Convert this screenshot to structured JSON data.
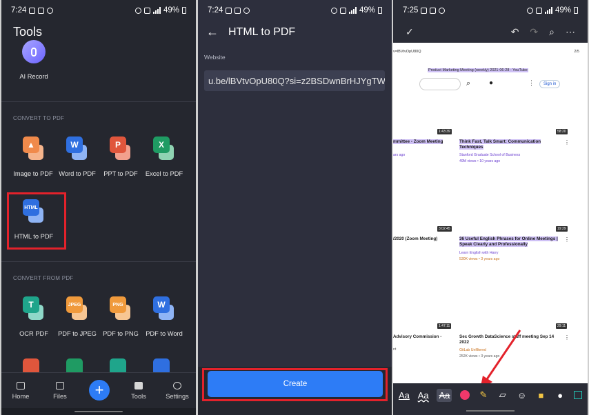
{
  "panel1": {
    "status": {
      "time": "7:24",
      "battery": "49%"
    },
    "title": "Tools",
    "ai_record": "AI Record",
    "convert_to_pdf_heading": "CONVERT TO PDF",
    "to_pdf_tools": [
      {
        "label": "Image to PDF",
        "icon": "image-icon",
        "color": "#f08a4b"
      },
      {
        "label": "Word to PDF",
        "icon": "word-icon",
        "color": "#2f6fe0",
        "letter": "W"
      },
      {
        "label": "PPT to PDF",
        "icon": "ppt-icon",
        "color": "#e0563c",
        "letter": "P"
      },
      {
        "label": "Excel to PDF",
        "icon": "excel-icon",
        "color": "#1f9b63",
        "letter": "X"
      },
      {
        "label": "HTML to PDF",
        "icon": "html-icon",
        "color": "#2f6fe0",
        "letter": "HTML"
      }
    ],
    "convert_from_pdf_heading": "CONVERT FROM PDF",
    "from_pdf_tools": [
      {
        "label": "OCR PDF",
        "icon": "ocr-icon",
        "color": "#1fa58b",
        "letter": "T"
      },
      {
        "label": "PDF to JPEG",
        "icon": "jpeg-icon",
        "color": "#f09a3c",
        "letter": "JPEG"
      },
      {
        "label": "PDF to PNG",
        "icon": "png-icon",
        "color": "#f09a3c",
        "letter": "PNG"
      },
      {
        "label": "PDF to Word",
        "icon": "word-icon",
        "color": "#2f6fe0",
        "letter": "W"
      }
    ],
    "nav": {
      "home": "Home",
      "files": "Files",
      "tools": "Tools",
      "settings": "Settings"
    }
  },
  "panel2": {
    "status": {
      "time": "7:24",
      "battery": "49%"
    },
    "title": "HTML to PDF",
    "field_label": "Website",
    "url_value": "u.be/lBVtvOpU80Q?si=z2BSDwnBrHJYgTWI",
    "create_label": "Create"
  },
  "panel3": {
    "status": {
      "time": "7:25",
      "battery": "49%"
    },
    "url_small": "v=lBVtvOpU80Q",
    "page_num": "2/5",
    "doc_title": "Product Marketing Meeting (weekly) 2021-06-28 - YouTube",
    "sign_in": "Sign in",
    "videos": [
      {
        "title": "mmittee - Zoom Meeting",
        "sub": "ars ago",
        "dur": "1:43:39"
      },
      {
        "title": "Think Fast, Talk Smart: Communication Techniques",
        "sub": "Stanford Graduate School of Business",
        "sub2": "49M views • 10 years ago",
        "dur": "58:20"
      },
      {
        "title": "/2020 (Zoom Meeting)",
        "dur": "3:02:45"
      },
      {
        "title": "36 Useful English Phrases for Online Meetings | Speak Clearly and Professionally",
        "sub": "Learn English with Harry",
        "sub2": "530K views • 3 years ago",
        "dur": "19:29"
      },
      {
        "title": "Advisory Commission -",
        "sub": "nt",
        "dur": "1:47:11"
      },
      {
        "title": "Sec Growth DataScience staff meeting Sep 14 2022",
        "sub": "GitLab Unfiltered",
        "sub2": "252K views • 3 years ago",
        "dur": "29:11"
      }
    ]
  }
}
